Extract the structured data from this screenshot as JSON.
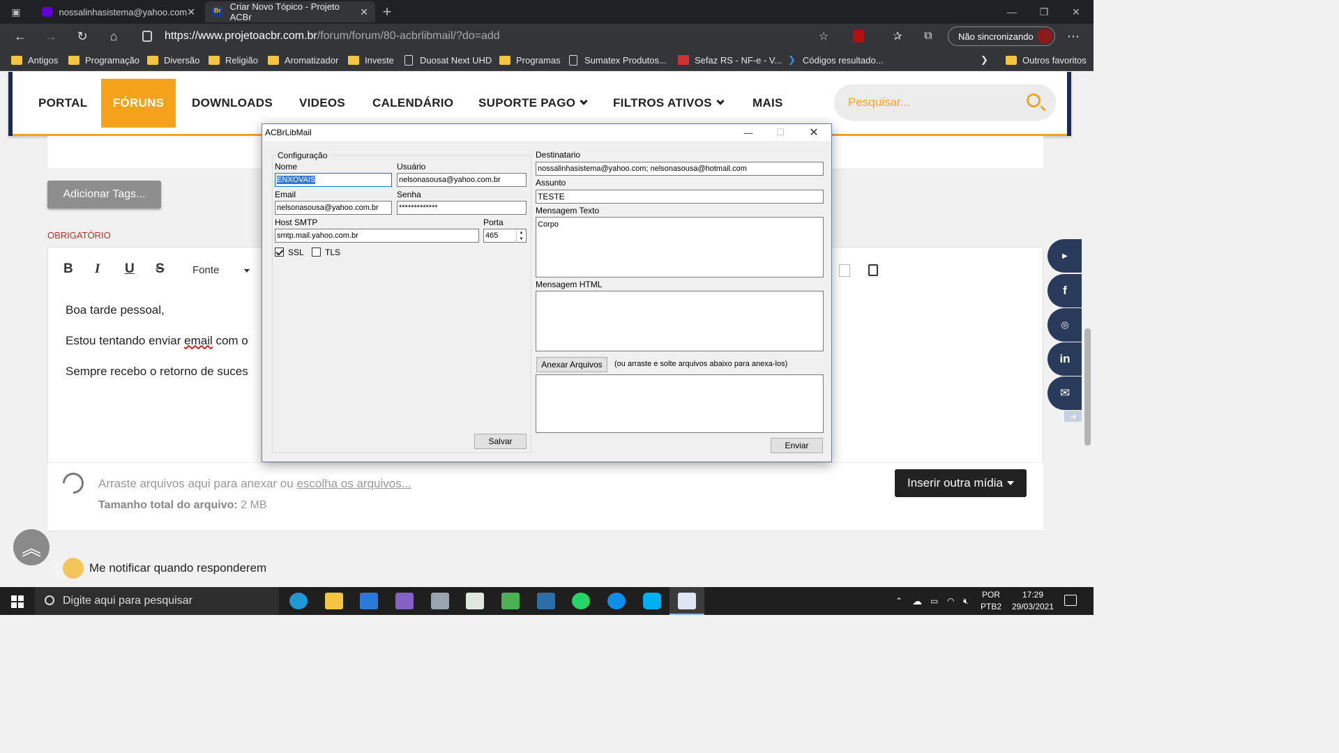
{
  "browser": {
    "tabs": [
      {
        "title": "nossalinhasistema@yahoo.com"
      },
      {
        "title": "Criar Novo Tópico - Projeto ACBr"
      }
    ],
    "url_host": "https://www.projetoacbr.com.br",
    "url_path": "/forum/forum/80-acbrlibmail/?do=add",
    "sync_label": "Não sincronizando",
    "favorites": [
      "Antigos",
      "Programação",
      "Diversão",
      "Religião",
      "Aromatizador",
      "Investe",
      "Duosat Next UHD",
      "Programas",
      "Sumatex Produtos...",
      "Sefaz RS - NF-e - V...",
      "Códigos resultado...",
      "Outros favoritos"
    ]
  },
  "site": {
    "menu": [
      "PORTAL",
      "FÓRUNS",
      "DOWNLOADS",
      "VIDEOS",
      "CALENDÁRIO",
      "SUPORTE PAGO",
      "FILTROS ATIVOS",
      "MAIS"
    ],
    "search_placeholder": "Pesquisar...",
    "tags_button": "Adicionar Tags...",
    "required_label": "OBRIGATÓRIO",
    "toolbar": {
      "bold": "B",
      "italic": "I",
      "underline": "U",
      "strike": "S",
      "font": "Fonte"
    },
    "editor_lines": [
      "Boa tarde pessoal,",
      "Estou tentando enviar ",
      "email",
      " com o",
      "Sempre recebo o retorno de suces"
    ],
    "attach_text": "Arraste arquivos aqui para anexar ou ",
    "attach_link": "escolha os arquivos...",
    "size_label": "Tamanho total do arquivo:",
    "size_value": " 2 MB",
    "insert_media": "Inserir outra mídia",
    "notify_label": "Me notificar quando responderem",
    "social": [
      "YouTube",
      "f",
      "ig",
      "in",
      "mail"
    ]
  },
  "dialog": {
    "title": "ACBrLibMail",
    "config_group": "Configuração",
    "nome_label": "Nome",
    "nome_value": "ENXOVAIS",
    "usuario_label": "Usuário",
    "usuario_value": "nelsonasousa@yahoo.com.br",
    "email_label": "Email",
    "email_value": "nelsonasousa@yahoo.com.br",
    "senha_label": "Senha",
    "senha_value": "*************",
    "host_label": "Host SMTP",
    "host_value": "smtp.mail.yahoo.com.br",
    "porta_label": "Porta",
    "porta_value": "465",
    "ssl_label": "SSL",
    "ssl_checked": true,
    "tls_label": "TLS",
    "tls_checked": false,
    "salvar_label": "Salvar",
    "destinatario_label": "Destinatario",
    "destinatario_value": "nossalinhasistema@yahoo.com; nelsonasousa@hotmail.com",
    "assunto_label": "Assunto",
    "assunto_value": "TESTE",
    "msg_texto_label": "Mensagem Texto",
    "msg_texto_value": "Corpo",
    "msg_html_label": "Mensagem HTML",
    "msg_html_value": "",
    "anexar_label": "Anexar Arquivos",
    "anexar_hint": "(ou arraste e solte arquivos abaixo para anexa-los)",
    "enviar_label": "Enviar"
  },
  "taskbar": {
    "search_placeholder": "Digite aqui para pesquisar",
    "lang_top": "POR",
    "lang_bottom": "PTB2",
    "time": "17:29",
    "date": "29/03/2021"
  },
  "colors": {
    "accent": "#f7a21b",
    "navy": "#2a3a5a",
    "browser_dark": "#202124"
  }
}
